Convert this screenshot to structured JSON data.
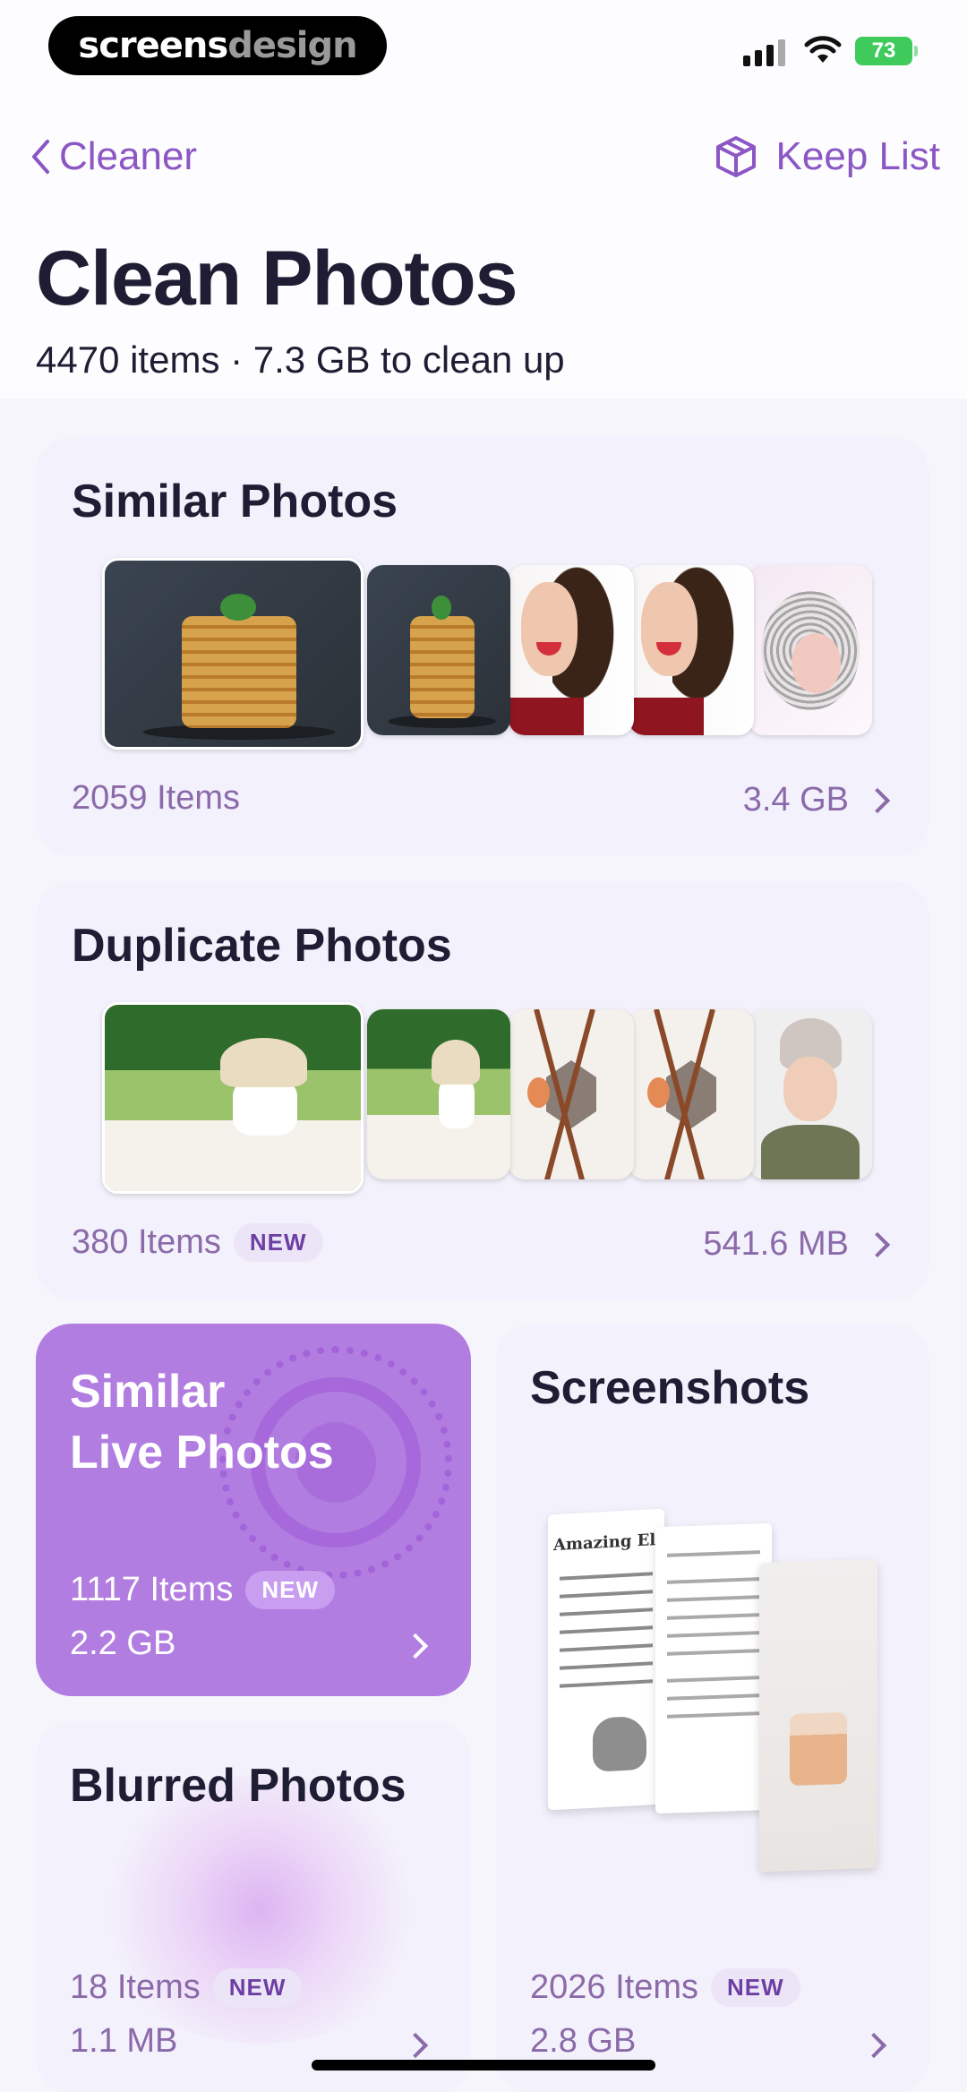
{
  "status_bar": {
    "watermark_a": "screens",
    "watermark_b": "design",
    "battery": "73"
  },
  "nav": {
    "back_label": "Cleaner",
    "keep_label": "Keep List"
  },
  "header": {
    "title": "Clean Photos",
    "subtitle": "4470 items · 7.3 GB to clean up"
  },
  "cards": {
    "similar": {
      "title": "Similar Photos",
      "count": "2059 Items",
      "size": "3.4 GB"
    },
    "duplicate": {
      "title": "Duplicate Photos",
      "count": "380 Items",
      "badge": "NEW",
      "size": "541.6 MB"
    },
    "live": {
      "title_line1": "Similar",
      "title_line2": "Live Photos",
      "count": "1117 Items",
      "badge": "NEW",
      "size": "2.2 GB"
    },
    "screenshots": {
      "title": "Screenshots",
      "count": "2026 Items",
      "badge": "NEW",
      "size": "2.8 GB",
      "doc_heading": "Amazing Elephant"
    },
    "blurred": {
      "title": "Blurred Photos",
      "count": "18 Items",
      "badge": "NEW",
      "size": "1.1 MB"
    }
  },
  "colors": {
    "accent": "#8b57c4",
    "live_card": "#b27de0",
    "card_bg": "#f3f1fb"
  }
}
